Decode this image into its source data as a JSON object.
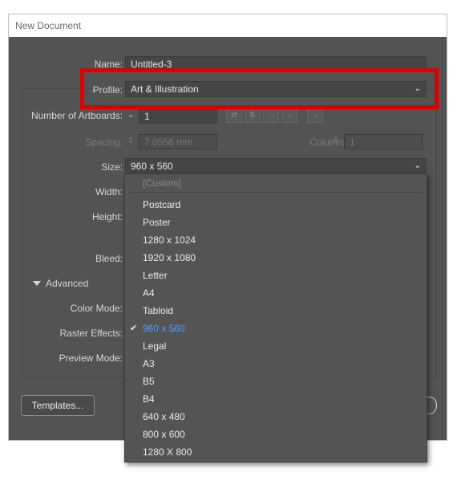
{
  "dialog": {
    "title": "New Document"
  },
  "fields": {
    "name_label": "Name:",
    "name_value": "Untitled-3",
    "profile_label": "Profile:",
    "profile_value": "Art & Illustration",
    "artboards_label": "Number of Artboards:",
    "artboards_value": "1",
    "spacing_label": "Spacing:",
    "spacing_value": "7.0556 mm",
    "columns_label": "Columns:",
    "columns_value": "1",
    "size_label": "Size:",
    "size_value": "960 x 560",
    "width_label": "Width:",
    "height_label": "Height:",
    "bleed_label": "Bleed:",
    "advanced_label": "Advanced",
    "color_mode_label": "Color Mode:",
    "raster_effects_label": "Raster Effects:",
    "preview_mode_label": "Preview Mode:"
  },
  "buttons": {
    "templates_label": "Templates..."
  },
  "size_dropdown": {
    "header": "[Custom]",
    "options": [
      "Postcard",
      "Poster",
      "1280 x 1024",
      "1920 x 1080",
      "Letter",
      "A4",
      "Tabloid",
      "960 x 560",
      "Legal",
      "A3",
      "B5",
      "B4",
      "640 x 480",
      "800 x 600",
      "1280 X 800"
    ],
    "selected": "960 x 560"
  },
  "highlight": {
    "color": "#e00000"
  },
  "colors": {
    "dialog_bg": "#535353",
    "selected_text": "#4aa3ff"
  }
}
